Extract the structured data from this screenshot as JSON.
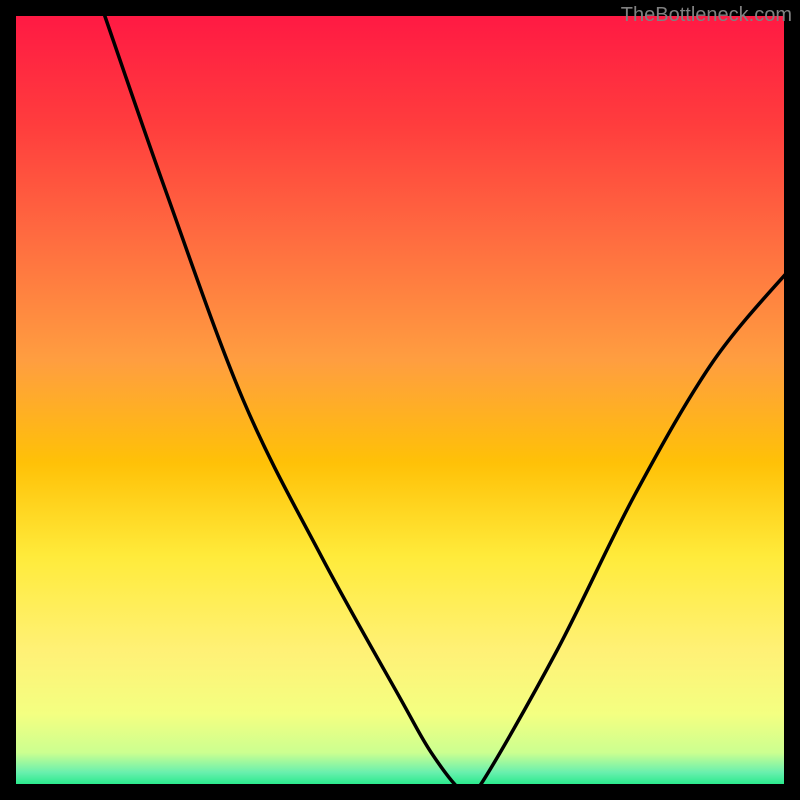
{
  "attribution": "TheBottleneck.com",
  "chart_data": {
    "type": "line",
    "title": "",
    "xlabel": "",
    "ylabel": "",
    "xlim": [
      0,
      100
    ],
    "ylim": [
      0,
      100
    ],
    "series": [
      {
        "name": "curve",
        "x": [
          12,
          20,
          30,
          40,
          50,
          54,
          58,
          60,
          70,
          80,
          90,
          100
        ],
        "y": [
          100,
          77,
          50,
          30,
          12,
          5,
          0,
          0.5,
          18,
          38,
          55,
          67
        ]
      }
    ],
    "marker": {
      "x_range": [
        56,
        60
      ],
      "y": 0
    },
    "gradient_bands": [
      {
        "offset": 0.0,
        "color": "#ff1744"
      },
      {
        "offset": 0.15,
        "color": "#ff3d3d"
      },
      {
        "offset": 0.3,
        "color": "#ff6e40"
      },
      {
        "offset": 0.45,
        "color": "#ff9e40"
      },
      {
        "offset": 0.58,
        "color": "#ffc107"
      },
      {
        "offset": 0.7,
        "color": "#ffeb3b"
      },
      {
        "offset": 0.82,
        "color": "#fff176"
      },
      {
        "offset": 0.9,
        "color": "#f4ff81"
      },
      {
        "offset": 0.95,
        "color": "#ccff90"
      },
      {
        "offset": 0.975,
        "color": "#69f0ae"
      },
      {
        "offset": 1.0,
        "color": "#00e676"
      }
    ],
    "marker_color": "#ff5252",
    "curve_color": "#000000",
    "border_color": "#000000"
  }
}
